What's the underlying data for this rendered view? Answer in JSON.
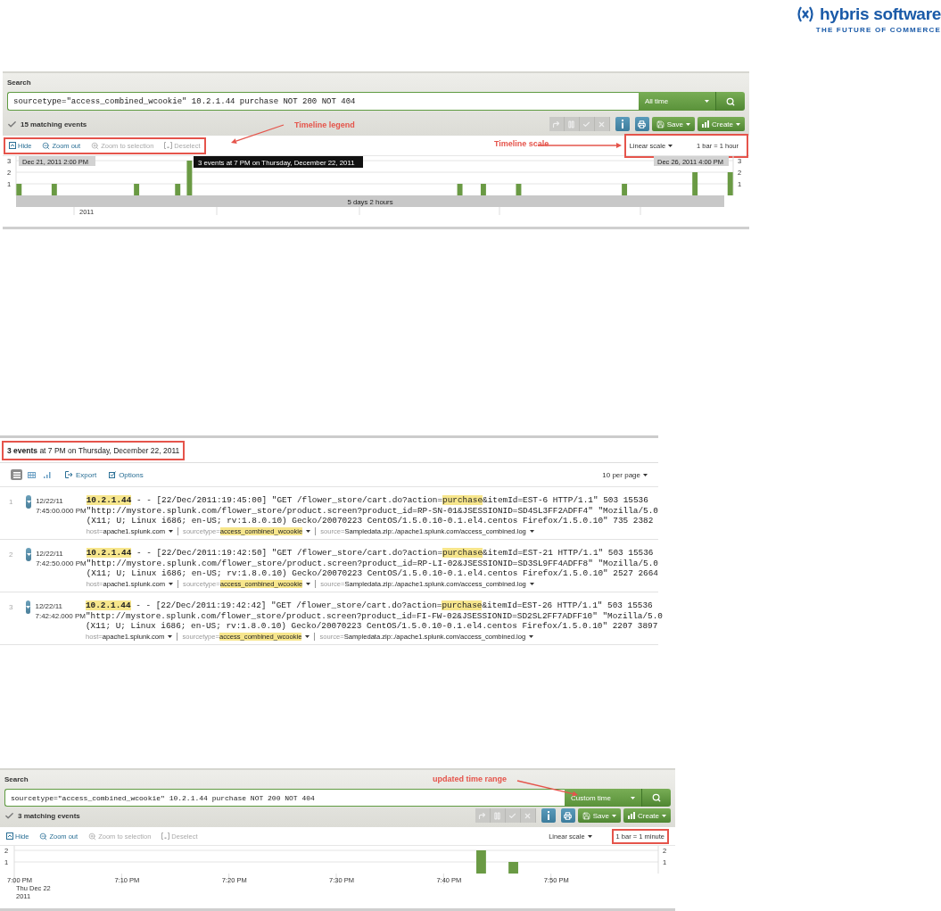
{
  "logo": {
    "name": "hybris software",
    "tagline": "THE FUTURE OF COMMERCE"
  },
  "sections": [
    {
      "kind": "search",
      "label": "Search",
      "query": "sourcetype=\"access_combined_wcookie\" 10.2.1.44 purchase NOT 200 NOT 404",
      "time_range": "All time",
      "status": "15 matching events",
      "toolbar": [
        {
          "kind": "jump",
          "disabled": true
        },
        {
          "kind": "pause",
          "disabled": true
        },
        {
          "kind": "finalize",
          "disabled": true
        },
        {
          "kind": "cancel",
          "disabled": true
        },
        {
          "kind": "info",
          "disabled": false
        },
        {
          "kind": "print",
          "disabled": false
        }
      ],
      "save": "Save",
      "create": "Create",
      "legend": [
        {
          "kind": "hide",
          "label": "Hide",
          "disabled": false
        },
        {
          "kind": "zoom_out",
          "label": "Zoom out",
          "disabled": false
        },
        {
          "kind": "zoom_selection",
          "label": "Zoom to selection",
          "disabled": true
        },
        {
          "kind": "deselect",
          "label": "Deselect",
          "disabled": true
        }
      ],
      "scale": "Linear scale",
      "bar_size": "1 bar = 1 hour",
      "callouts": [
        {
          "kind": "legend",
          "label": "Timeline legend",
          "boxed": true
        },
        {
          "kind": "scale",
          "label": "Timeline scale",
          "boxed": true
        }
      ],
      "timeline": {
        "right_axis_labels": [
          "3",
          "2",
          "1"
        ],
        "start_label": "Dec 21, 2011 2:00 PM",
        "tooltip": "3 events at 7 PM on Thursday, December 22, 2011",
        "end_label": "Dec 26, 2011 4:00 PM",
        "span": "5 days 2 hours",
        "year_label": "2011",
        "chart_data": {
          "type": "bar",
          "categories": [
            null,
            null,
            null,
            null,
            null,
            null,
            null,
            null,
            null,
            null,
            null,
            null,
            null,
            null,
            null,
            null,
            null,
            null,
            null,
            null,
            null,
            null,
            null,
            null,
            null,
            null,
            null,
            null,
            null,
            null,
            null,
            null,
            null,
            null,
            null,
            null,
            null,
            null,
            null,
            null,
            null,
            null,
            null,
            null,
            null,
            null,
            null,
            null,
            null,
            null,
            null,
            null,
            null,
            null,
            null,
            null,
            null,
            null,
            null,
            null,
            null,
            null,
            null,
            null,
            null,
            null,
            null,
            null,
            null,
            null,
            null,
            null,
            null,
            null,
            null,
            null,
            null,
            null,
            null,
            null,
            null,
            null,
            null,
            null,
            null,
            null,
            null,
            null,
            null,
            null,
            null,
            null,
            null,
            null,
            null,
            null,
            null,
            null,
            null,
            null,
            null,
            null,
            null,
            null,
            null,
            null,
            null,
            null,
            null,
            null,
            null,
            null,
            null,
            null,
            null,
            null,
            null,
            null,
            null,
            null,
            null,
            null
          ],
          "values": [
            1,
            null,
            null,
            null,
            null,
            null,
            1,
            null,
            null,
            null,
            null,
            null,
            null,
            null,
            null,
            null,
            null,
            null,
            null,
            null,
            1,
            null,
            null,
            null,
            null,
            null,
            null,
            1,
            null,
            3,
            null,
            null,
            null,
            null,
            null,
            null,
            null,
            null,
            null,
            null,
            null,
            null,
            null,
            null,
            null,
            null,
            null,
            null,
            null,
            null,
            null,
            null,
            null,
            null,
            null,
            null,
            null,
            null,
            null,
            null,
            null,
            null,
            null,
            null,
            null,
            null,
            null,
            null,
            null,
            null,
            null,
            null,
            null,
            null,
            null,
            1,
            null,
            null,
            null,
            1,
            null,
            null,
            null,
            null,
            null,
            1,
            null,
            null,
            null,
            null,
            null,
            null,
            null,
            null,
            null,
            null,
            null,
            null,
            null,
            null,
            null,
            null,
            null,
            1,
            null,
            null,
            null,
            null,
            null,
            null,
            null,
            null,
            null,
            null,
            null,
            2,
            null,
            null,
            null,
            null,
            null,
            2
          ],
          "ylim": [
            0,
            3
          ],
          "yticks": [
            1,
            2,
            3
          ]
        }
      }
    },
    {
      "kind": "events",
      "heading": "**3 events** at 7 PM on Thursday, December 22, 2011",
      "heading_boxed": true,
      "views": [
        {
          "kind": "list",
          "selected": true
        },
        {
          "kind": "table",
          "selected": false
        },
        {
          "kind": "chart",
          "selected": false
        }
      ],
      "actions": [
        {
          "kind": "export",
          "label": "Export"
        },
        {
          "kind": "options",
          "label": "Options"
        }
      ],
      "per_page": "10 per page",
      "events": [
        {
          "number": "1",
          "date": "12/22/11",
          "time": "7:45:00.000 PM",
          "lines": [
            [
              {
                "text": "**10.2.1.44**",
                "highlighted": true
              },
              {
                "text": " - - [22/Dec/2011:19:45:00] \"GET /flower_store/cart.do?action=",
                "highlighted": false
              },
              {
                "text": "purchase",
                "highlighted": true
              },
              {
                "text": "&itemId=EST-6 HTTP/1.1\" 503 15536",
                "highlighted": false
              }
            ],
            [
              {
                "text": "\"http://mystore.splunk.com/flower_store/product.screen?product_id=RP-SN-01&JSESSIONID=SD4SL3FF2ADFF4\" \"Mozilla/5.0",
                "highlighted": false
              }
            ],
            [
              {
                "text": "(X11; U; Linux i686; en-US; rv:1.8.0.10) Gecko/20070223 CentOS/1.5.0.10-0.1.el4.centos Firefox/1.5.0.10\" 735 2382",
                "highlighted": false
              }
            ]
          ],
          "fields": [
            {
              "key": "host=",
              "value": "apache1.splunk.com",
              "highlighted": false
            },
            {
              "key": "sourcetype=",
              "value": "access_combined_wcookie",
              "highlighted": true
            },
            {
              "key": "source=",
              "value": "Sampledata.zip:./apache1.splunk.com/access_combined.log",
              "highlighted": false
            }
          ]
        },
        {
          "number": "2",
          "date": "12/22/11",
          "time": "7:42:50.000 PM",
          "lines": [
            [
              {
                "text": "**10.2.1.44**",
                "highlighted": true
              },
              {
                "text": " - - [22/Dec/2011:19:42:50] \"GET /flower_store/cart.do?action=",
                "highlighted": false
              },
              {
                "text": "purchase",
                "highlighted": true
              },
              {
                "text": "&itemId=EST-21 HTTP/1.1\" 503 15536",
                "highlighted": false
              }
            ],
            [
              {
                "text": "\"http://mystore.splunk.com/flower_store/product.screen?product_id=RP-LI-02&JSESSIONID=SD3SL9FF4ADFF8\" \"Mozilla/5.0",
                "highlighted": false
              }
            ],
            [
              {
                "text": "(X11; U; Linux i686; en-US; rv:1.8.0.10) Gecko/20070223 CentOS/1.5.0.10-0.1.el4.centos Firefox/1.5.0.10\" 2527 2664",
                "highlighted": false
              }
            ]
          ],
          "fields": [
            {
              "key": "host=",
              "value": "apache1.splunk.com",
              "highlighted": false
            },
            {
              "key": "sourcetype=",
              "value": "access_combined_wcookie",
              "highlighted": true
            },
            {
              "key": "source=",
              "value": "Sampledata.zip:./apache1.splunk.com/access_combined.log",
              "highlighted": false
            }
          ]
        },
        {
          "number": "3",
          "date": "12/22/11",
          "time": "7:42:42.000 PM",
          "lines": [
            [
              {
                "text": "**10.2.1.44**",
                "highlighted": true
              },
              {
                "text": " - - [22/Dec/2011:19:42:42] \"GET /flower_store/cart.do?action=",
                "highlighted": false
              },
              {
                "text": "purchase",
                "highlighted": true
              },
              {
                "text": "&itemId=EST-26 HTTP/1.1\" 503 15536",
                "highlighted": false
              }
            ],
            [
              {
                "text": "\"http://mystore.splunk.com/flower_store/product.screen?product_id=FI-FW-02&JSESSIONID=SD2SL2FF7ADFF10\" \"Mozilla/5.0",
                "highlighted": false
              }
            ],
            [
              {
                "text": "(X11; U; Linux i686; en-US; rv:1.8.0.10) Gecko/20070223 CentOS/1.5.0.10-0.1.el4.centos Firefox/1.5.0.10\" 2207 3897",
                "highlighted": false
              }
            ]
          ],
          "fields": [
            {
              "key": "host=",
              "value": "apache1.splunk.com",
              "highlighted": false
            },
            {
              "key": "sourcetype=",
              "value": "access_combined_wcookie",
              "highlighted": true
            },
            {
              "key": "source=",
              "value": "Sampledata.zip:./apache1.splunk.com/access_combined.log",
              "highlighted": false
            }
          ]
        }
      ]
    },
    {
      "kind": "search",
      "label": "Search",
      "query": "sourcetype=\"access_combined_wcookie\" 10.2.1.44 purchase NOT 200 NOT 404",
      "time_range": "Custom time",
      "status": "3 matching events",
      "toolbar": [
        {
          "kind": "jump",
          "disabled": true
        },
        {
          "kind": "pause",
          "disabled": true
        },
        {
          "kind": "finalize",
          "disabled": true
        },
        {
          "kind": "cancel",
          "disabled": true
        },
        {
          "kind": "info",
          "disabled": false
        },
        {
          "kind": "print",
          "disabled": false
        }
      ],
      "save": "Save",
      "create": "Create",
      "legend": [
        {
          "kind": "hide",
          "label": "Hide",
          "disabled": false
        },
        {
          "kind": "zoom_out",
          "label": "Zoom out",
          "disabled": false
        },
        {
          "kind": "zoom_selection",
          "label": "Zoom to selection",
          "disabled": true
        },
        {
          "kind": "deselect",
          "label": "Deselect",
          "disabled": true
        }
      ],
      "scale": "Linear scale",
      "bar_size": "1 bar = 1 minute",
      "callouts": [
        {
          "kind": "time_range",
          "label": "updated time range",
          "boxed": false
        },
        {
          "kind": "bar_size",
          "boxed": true
        }
      ],
      "timeline": {
        "left_axis_labels": [
          "2",
          "1"
        ],
        "date_label": "Thu Dec 22",
        "year_label": "2011",
        "chart_data": {
          "type": "bar",
          "categories": [
            "7:00 PM",
            null,
            null,
            null,
            null,
            null,
            null,
            null,
            null,
            null,
            "7:10 PM",
            null,
            null,
            null,
            null,
            null,
            null,
            null,
            null,
            null,
            "7:20 PM",
            null,
            null,
            null,
            null,
            null,
            null,
            null,
            null,
            null,
            "7:30 PM",
            null,
            null,
            null,
            null,
            null,
            null,
            null,
            null,
            null,
            "7:40 PM",
            null,
            null,
            null,
            null,
            null,
            null,
            null,
            null,
            null,
            "7:50 PM",
            null,
            null,
            null,
            null,
            null,
            null,
            null,
            null,
            null
          ],
          "values": [
            null,
            null,
            null,
            null,
            null,
            null,
            null,
            null,
            null,
            null,
            null,
            null,
            null,
            null,
            null,
            null,
            null,
            null,
            null,
            null,
            null,
            null,
            null,
            null,
            null,
            null,
            null,
            null,
            null,
            null,
            null,
            null,
            null,
            null,
            null,
            null,
            null,
            null,
            null,
            null,
            null,
            null,
            null,
            2,
            null,
            null,
            1,
            null,
            null,
            null,
            null,
            null,
            null,
            null,
            null,
            null,
            null,
            null,
            null,
            null
          ],
          "ylim": [
            0,
            2
          ],
          "yticks": [
            1,
            2
          ]
        }
      }
    }
  ]
}
